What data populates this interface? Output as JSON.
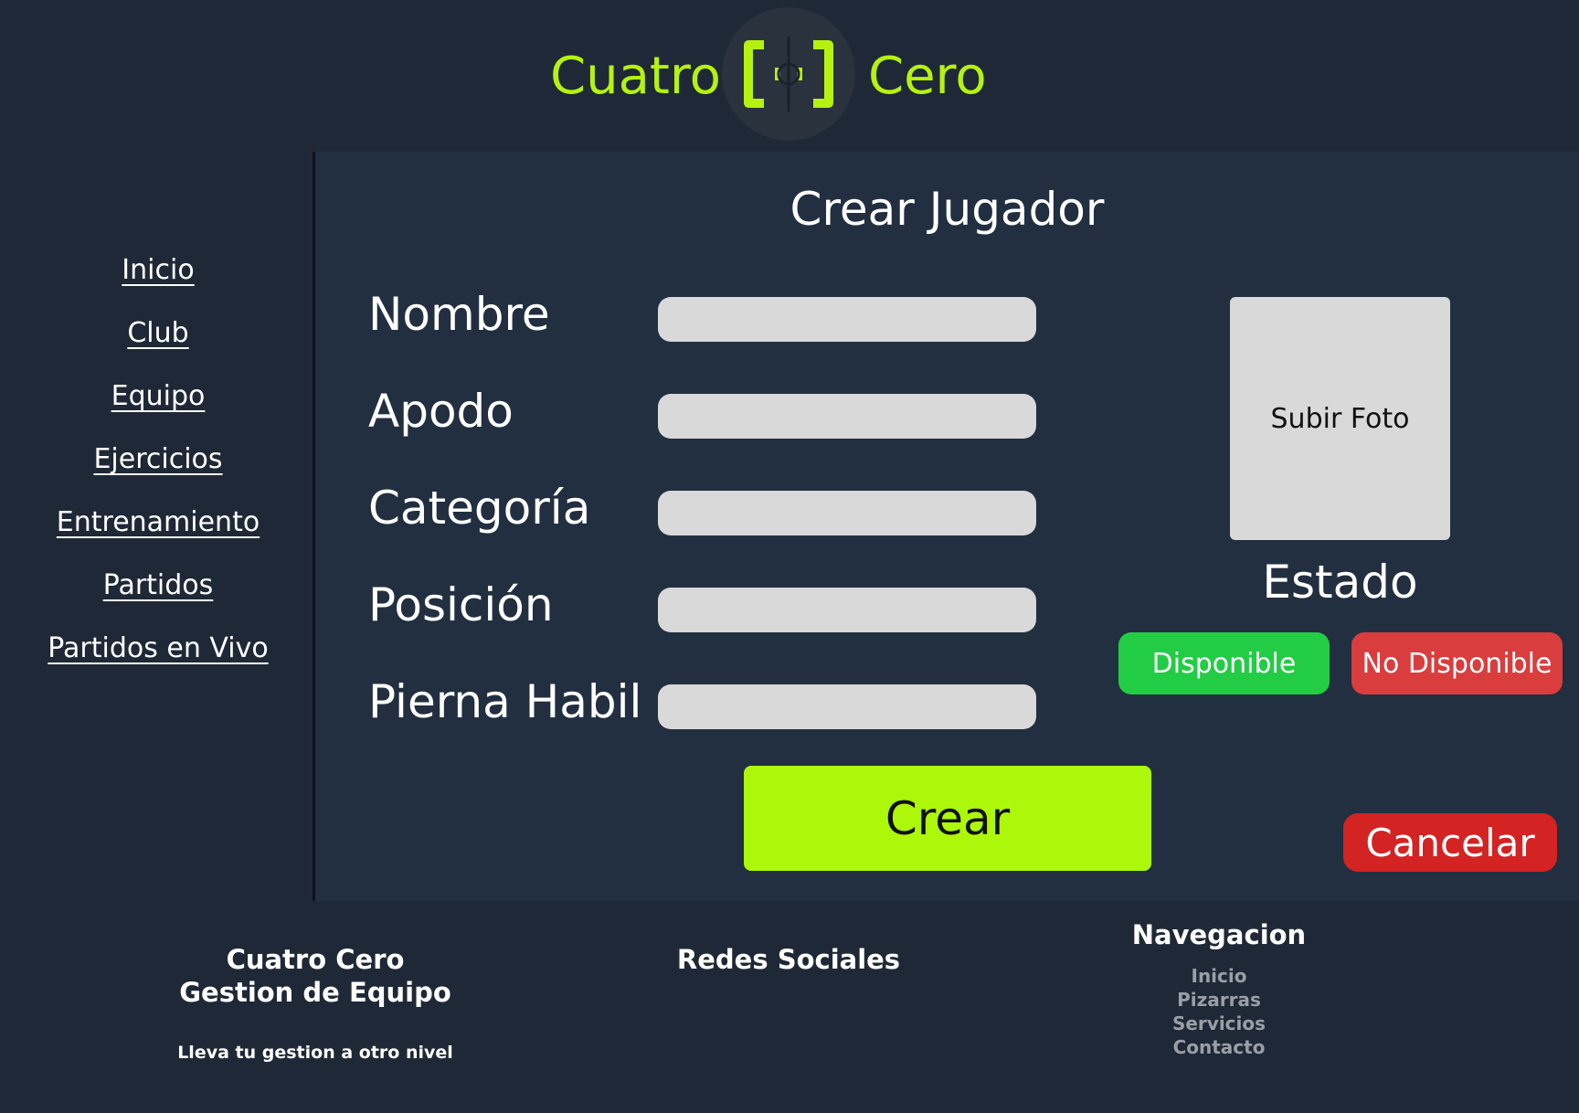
{
  "header": {
    "brand_left": "Cuatro",
    "brand_right": "Cero",
    "logo_icon": "bracket-logo-icon",
    "accent_color": "#b5f20f"
  },
  "sidebar": {
    "items": [
      {
        "label": "Inicio"
      },
      {
        "label": "Club"
      },
      {
        "label": "Equipo"
      },
      {
        "label": "Ejercicios"
      },
      {
        "label": "Entrenamiento"
      },
      {
        "label": "Partidos"
      },
      {
        "label": "Partidos en Vivo"
      }
    ]
  },
  "form": {
    "title": "Crear Jugador",
    "fields": [
      {
        "label": "Nombre",
        "value": ""
      },
      {
        "label": "Apodo",
        "value": ""
      },
      {
        "label": "Categoría",
        "value": ""
      },
      {
        "label": "Posición",
        "value": ""
      },
      {
        "label": "Pierna Habil",
        "value": ""
      }
    ],
    "photo_label": "Subir Foto",
    "estado_label": "Estado",
    "disponible_label": "Disponible",
    "no_disponible_label": "No Disponible",
    "create_label": "Crear",
    "cancel_label": "Cancelar",
    "colors": {
      "disponible": "#22cc44",
      "no_disponible": "#d93d3d",
      "create": "#adf70a",
      "cancel": "#d32323"
    }
  },
  "footer": {
    "brand_line1": "Cuatro Cero",
    "brand_line2": "Gestion de Equipo",
    "tagline": "Lleva tu gestion a otro nivel",
    "social_title": "Redes Sociales",
    "nav_title": "Navegacion",
    "nav_items": [
      "Inicio",
      "Pizarras",
      "Servicios",
      "Contacto"
    ]
  }
}
